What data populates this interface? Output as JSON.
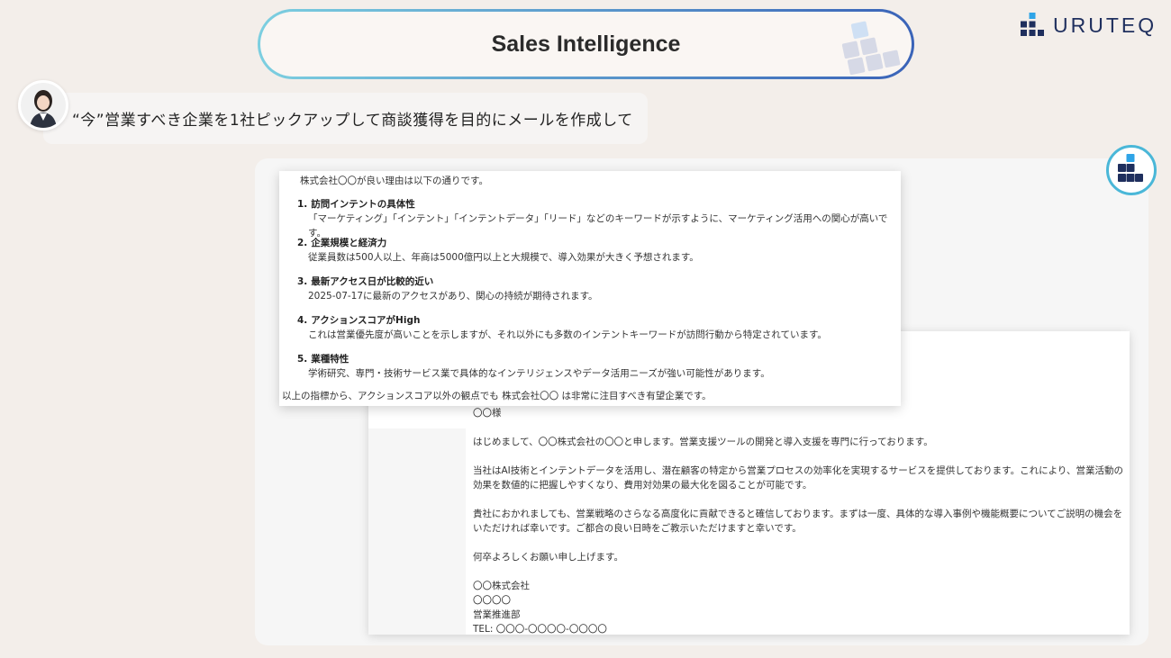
{
  "header": {
    "title": "Sales Intelligence"
  },
  "brand": {
    "name": "URUTEQ"
  },
  "prompt": {
    "text": "“今”営業すべき企業を1社ピックアップして商談獲得を目的にメールを作成して"
  },
  "reasons": {
    "intro": "株式会社〇〇が良い理由は以下の通りです。",
    "items": [
      {
        "num": "1.",
        "heading": "訪問インテントの具体性",
        "desc": "「マーケティング」「インテント」「インテントデータ」「リード」などのキーワードが示すように、マーケティング活用への関心が高いです。"
      },
      {
        "num": "2.",
        "heading": "企業規模と経済力",
        "desc": "従業員数は500人以上、年商は5000億円以上と大規模で、導入効果が大きく予想されます。"
      },
      {
        "num": "3.",
        "heading": "最新アクセス日が比較的近い",
        "desc": "2025-07-17に最新のアクセスがあり、関心の持続が期待されます。"
      },
      {
        "num": "4.",
        "heading": "アクションスコアがHigh",
        "desc": "これは営業優先度が高いことを示しますが、それ以外にも多数のインテントキーワードが訪問行動から特定されています。"
      },
      {
        "num": "5.",
        "heading": "業種特性",
        "desc": "学術研究、専門・技術サービス業で具体的なインテリジェンスやデータ活用ニーズが強い可能性があります。"
      }
    ],
    "outro": "以上の指標から、アクションスコア以外の観点でも 株式会社〇〇 は非常に注目すべき有望企業です。"
  },
  "email": {
    "salutation": "〇〇様",
    "p1": "はじめまして、〇〇株式会社の〇〇と申します。営業支援ツールの開発と導入支援を専門に行っております。",
    "p2": "当社はAI技術とインテントデータを活用し、潜在顧客の特定から営業プロセスの効率化を実現するサービスを提供しております。これにより、営業活動の効果を数値的に把握しやすくなり、費用対効果の最大化を図ることが可能です。",
    "p3": "貴社におかれましても、営業戦略のさらなる高度化に貢献できると確信しております。まずは一度、具体的な導入事例や機能概要についてご説明の機会をいただければ幸いです。ご都合の良い日時をご教示いただけますと幸いです。",
    "p4": "何卒よろしくお願い申し上げます。",
    "signature": {
      "company": "〇〇株式会社",
      "name": "〇〇〇〇",
      "department": "営業推進部",
      "tel": "TEL: 〇〇〇-〇〇〇〇-〇〇〇〇"
    }
  }
}
